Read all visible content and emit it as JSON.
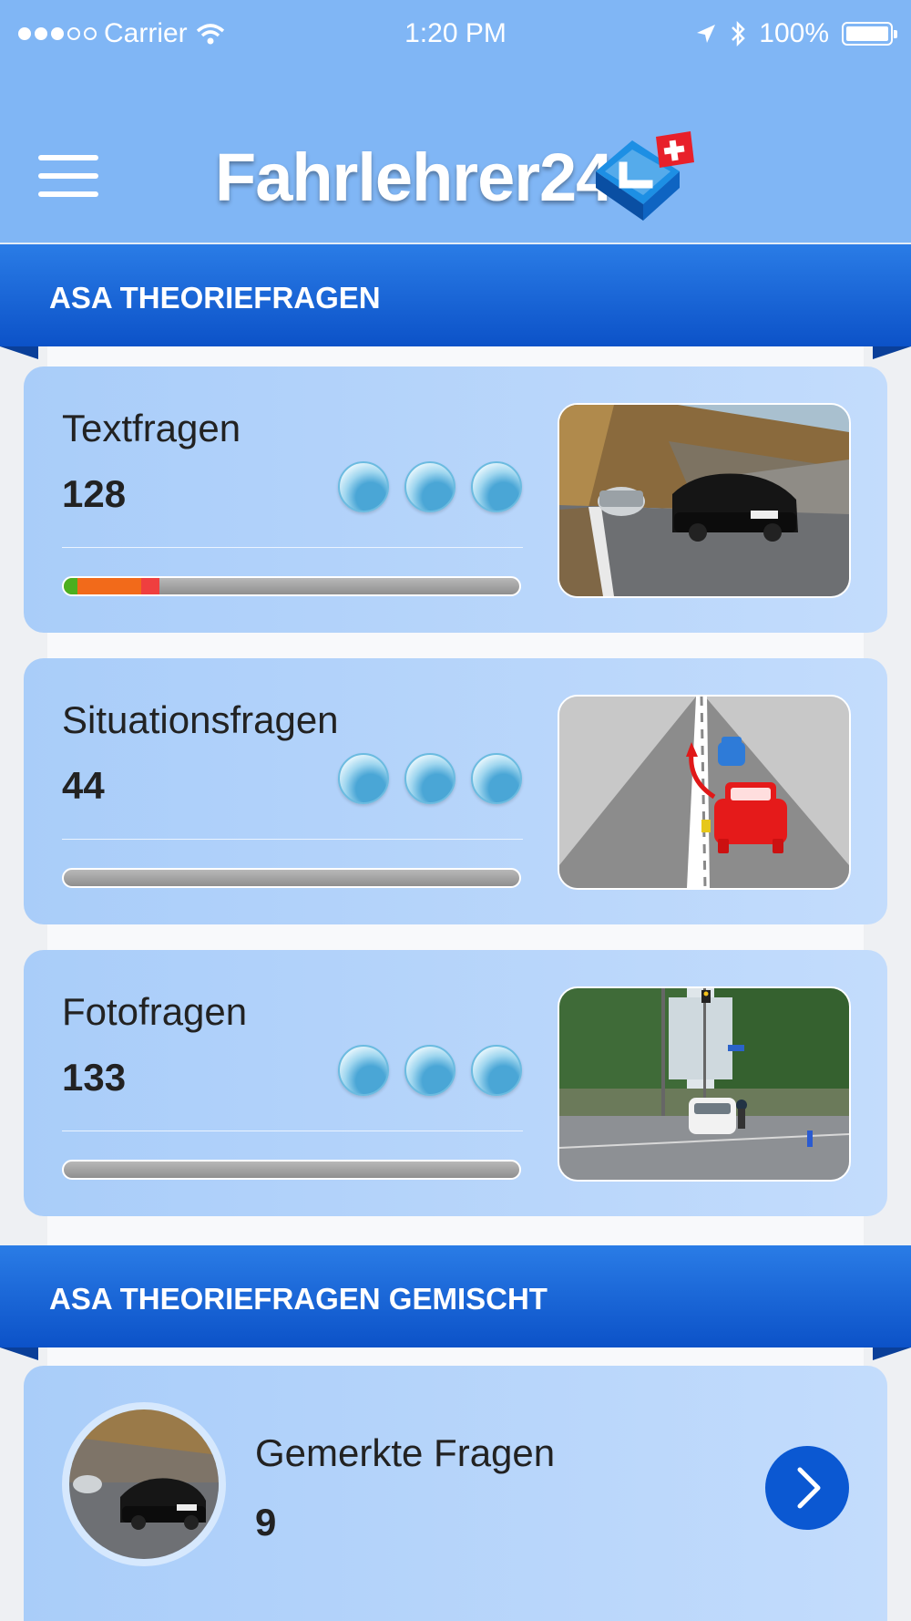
{
  "status_bar": {
    "carrier": "Carrier",
    "time": "1:20 PM",
    "battery": "100%",
    "signal_icon": "signal-dots-icon",
    "wifi_icon": "wifi-icon",
    "location_icon": "location-arrow-icon",
    "bluetooth_icon": "bluetooth-icon"
  },
  "header": {
    "title": "Fahrlehrer24",
    "menu_icon": "hamburger-menu-icon",
    "logo_icon": "l-sign-swiss-flag-logo-icon"
  },
  "section1": {
    "title": "ASA THEORIEFRAGEN",
    "cards": [
      {
        "title": "Textfragen",
        "count": "128",
        "medals": 3,
        "thumbnail": "photo-road-cars",
        "progress": [
          {
            "color": "#4caf1f",
            "fraction": 0.03
          },
          {
            "color": "#f26a1a",
            "fraction": 0.14
          },
          {
            "color": "#ef3f3f",
            "fraction": 0.04
          }
        ]
      },
      {
        "title": "Situationsfragen",
        "count": "44",
        "medals": 3,
        "thumbnail": "diagram-road-overtaking",
        "progress": []
      },
      {
        "title": "Fotofragen",
        "count": "133",
        "medals": 3,
        "thumbnail": "photo-street-intersection",
        "progress": []
      }
    ]
  },
  "section2": {
    "title": "ASA THEORIEFRAGEN GEMISCHT",
    "card": {
      "title": "Gemerkte Fragen",
      "count": "9",
      "arrow_icon": "chevron-right-icon"
    }
  },
  "colors": {
    "status_nav_bg": "#80b6f5",
    "section_header_bg": "#0c52c8",
    "card_bg": "#b6d5fb",
    "arrow_button": "#0b58d2"
  }
}
